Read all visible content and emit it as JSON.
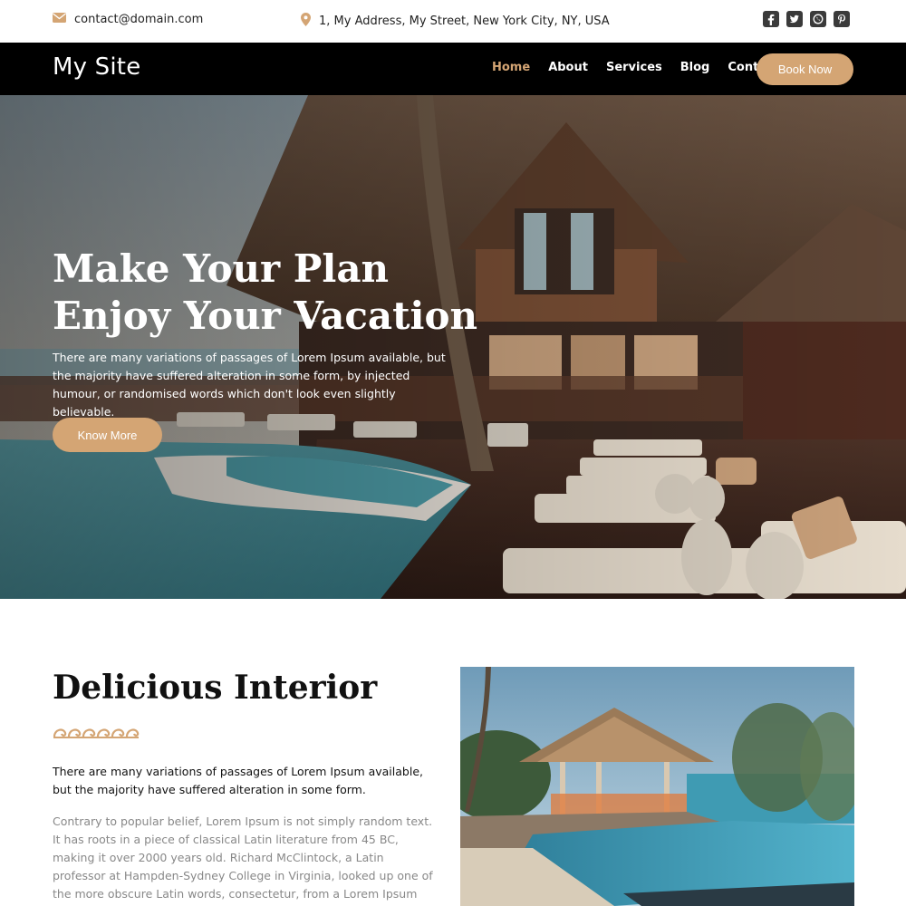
{
  "topbar": {
    "email": "contact@domain.com",
    "address": "1, My Address, My Street, New York City, NY, USA",
    "socials": [
      "facebook-icon",
      "twitter-icon",
      "whatsapp-icon",
      "pinterest-icon"
    ]
  },
  "nav": {
    "brand": "My Site",
    "links": [
      "Home",
      "About",
      "Services",
      "Blog",
      "Contact"
    ],
    "active": "Home",
    "cta": "Book Now"
  },
  "hero": {
    "title_line1": "Make Your Plan",
    "title_line2": "Enjoy Your Vacation",
    "text": "There are many variations of passages of Lorem Ipsum available, but the majority have suffered alteration in some form, by injected humour, or randomised words which don't look even slightly believable.",
    "button": "Know More"
  },
  "interior": {
    "title": "Delicious Interior",
    "lead": "There are many variations of passages of Lorem Ipsum available, but the majority have suffered alteration in some form.",
    "body": "Contrary to popular belief, Lorem Ipsum is not simply random text. It has roots in a piece of classical Latin literature from 45 BC, making it over 2000 years old. Richard McClintock, a Latin professor at Hampden-Sydney College in Virginia, looked up one of the more obscure Latin words, consectetur, from a Lorem Ipsum passage, and going through"
  },
  "colors": {
    "accent": "#d4a574",
    "nav_bg": "#000000",
    "muted_text": "#888888"
  }
}
